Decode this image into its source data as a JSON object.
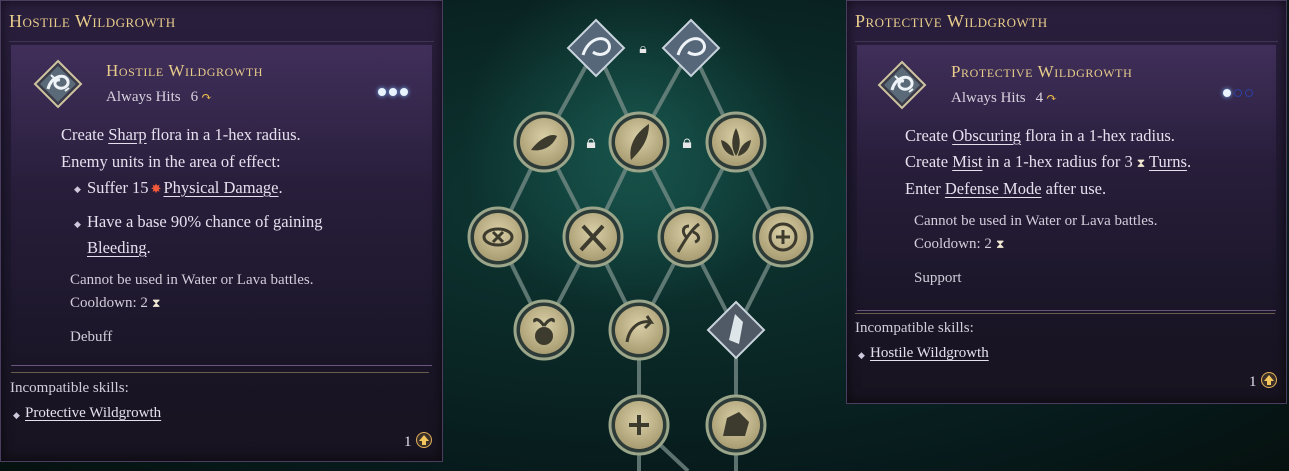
{
  "left_panel": {
    "title": "Hostile Wildgrowth",
    "skill_name": "Hostile Wildgrowth",
    "always_hits": "Always Hits",
    "cost": "6",
    "lines": {
      "l1_pre": "Create ",
      "l1_link": "Sharp",
      "l1_post": " flora in a 1-hex radius.",
      "l2": "Enemy units in the area of effect:",
      "b1_pre": "Suffer 15",
      "b1_link": "Physical Damage",
      "b1_post": ".",
      "b2_pre": "Have a base 90% chance of gaining",
      "b2_link": "Bleeding",
      "b2_post": "."
    },
    "restriction": "Cannot be used in Water or Lava battles.",
    "cooldown": "Cooldown: 2",
    "category": "Debuff",
    "incompatible_label": "Incompatible skills:",
    "incompatible_item": "Protective Wildgrowth",
    "level": "1"
  },
  "right_panel": {
    "title": "Protective Wildgrowth",
    "skill_name": "Protective Wildgrowth",
    "always_hits": "Always Hits",
    "cost": "4",
    "lines": {
      "l1_pre": "Create ",
      "l1_link": "Obscuring",
      "l1_post": " flora in a 1-hex radius.",
      "l2_pre": "Create ",
      "l2_link1": "Mist",
      "l2_mid": " in a 1-hex radius for 3",
      "l2_link2": "Turns",
      "l2_post": ".",
      "l3_pre": "Enter ",
      "l3_link": "Defense Mode",
      "l3_post": " after use."
    },
    "restriction": "Cannot be used in Water or Lava battles.",
    "cooldown": "Cooldown: 2",
    "category": "Support",
    "incompatible_label": "Incompatible skills:",
    "incompatible_item": "Hostile Wildgrowth",
    "level": "1"
  },
  "tree": {
    "nodes": [
      "dragon-crest-1",
      "dragon-crest-2",
      "hand-leaf",
      "vine-leaf",
      "lotus",
      "eye-cross",
      "no-sword",
      "vine-branch",
      "heal-plus",
      "skull-sprout",
      "arrow-leaf",
      "crystal-shard",
      "leaf-plus",
      "rock-vine"
    ]
  },
  "colors": {
    "gold": "#e8cc8c",
    "accent_blue": "#bfe0ff"
  }
}
